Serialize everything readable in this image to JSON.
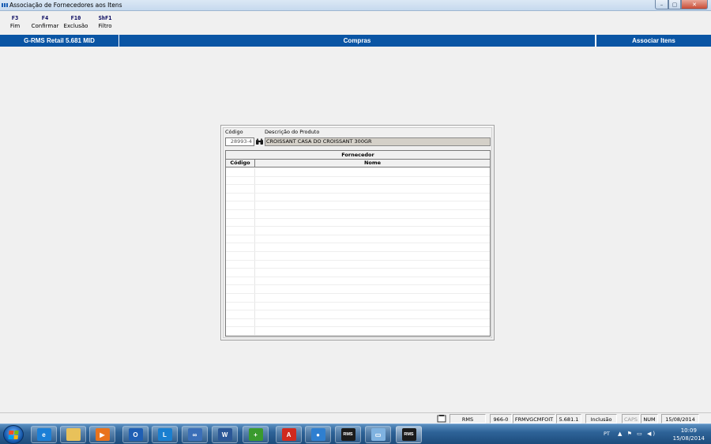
{
  "window": {
    "title": "Associação de Fornecedores aos Itens",
    "controls": {
      "minimize": "–",
      "maximize": "▢",
      "close": "✕"
    }
  },
  "toolbar": {
    "keys": [
      {
        "key": "F3",
        "label": "Fim"
      },
      {
        "key": "F4",
        "label": "Confirmar"
      },
      {
        "key": "F10",
        "label": "Exclusão"
      },
      {
        "key": "ShF1",
        "label": "Filtro"
      }
    ]
  },
  "header": {
    "app": "G-RMS Retail 5.681 MID",
    "module": "Compras",
    "screen": "Associar Itens",
    "color": "#0a55a4"
  },
  "form": {
    "codigo_label": "Código",
    "descricao_label": "Descrição do Produto",
    "codigo_value": "28993-4",
    "descricao_value": "CROISSANT CASA DO CROISSANT 300GR",
    "search_icon": "binoculars-icon"
  },
  "grid": {
    "group_header": "Fornecedor",
    "columns": [
      "Código",
      "Nome"
    ],
    "rows": []
  },
  "statusbar": {
    "items": [
      "RMS",
      "966-0",
      "FRMVGCMFOIT",
      "5.681.1",
      "Inclusão",
      "CAPS",
      "NUM",
      "15/08/2014"
    ]
  },
  "taskbar": {
    "apps": [
      {
        "name": "internet-explorer-icon",
        "glyph": "e",
        "color": "#1c7fd6"
      },
      {
        "name": "file-explorer-icon",
        "glyph": "",
        "color": "#e8c15a"
      },
      {
        "name": "media-player-icon",
        "glyph": "▶",
        "color": "#e9731c"
      },
      {
        "name": "outlook-icon",
        "glyph": "O",
        "color": "#1f5fb4"
      },
      {
        "name": "lync-icon",
        "glyph": "L",
        "color": "#1a7fd0"
      },
      {
        "name": "link-app-icon",
        "glyph": "∞",
        "color": "#3b6fb8"
      },
      {
        "name": "word-icon",
        "glyph": "W",
        "color": "#2b5797"
      },
      {
        "name": "stack-app-icon",
        "glyph": "+",
        "color": "#3a9a2e"
      },
      {
        "name": "acrobat-icon",
        "glyph": "A",
        "color": "#d02a1f"
      },
      {
        "name": "globe-app-icon",
        "glyph": "●",
        "color": "#2f7fd0"
      },
      {
        "name": "rms-app-icon",
        "glyph": "RMS",
        "color": "#1b1b1b"
      },
      {
        "name": "window-app-icon",
        "glyph": "▭",
        "color": "#7fb2e0"
      },
      {
        "name": "rms-app-active-icon",
        "glyph": "RMS",
        "color": "#1b1b1b"
      }
    ],
    "tray": {
      "lang": "PT",
      "icons": "▲ ⚑ ▭ ◀)",
      "time": "10:09",
      "date": "15/08/2014"
    }
  }
}
